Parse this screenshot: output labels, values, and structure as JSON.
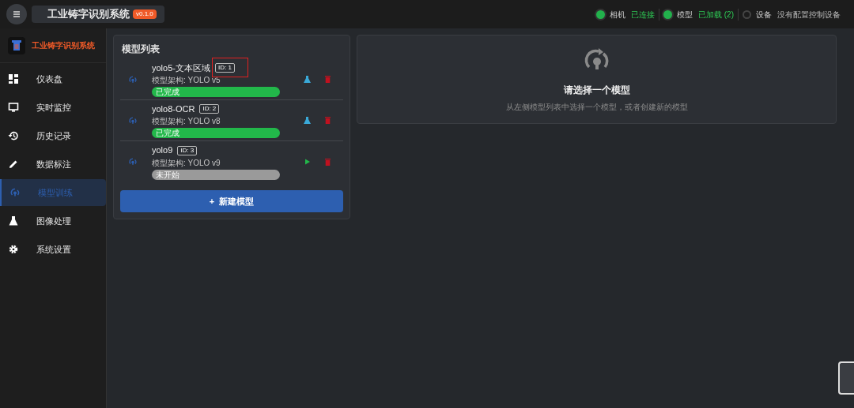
{
  "header": {
    "title": "工业铸字识别系统",
    "version": "v0.1.0"
  },
  "status": [
    {
      "label": "相机",
      "value": "已连接",
      "on": true
    },
    {
      "label": "模型",
      "value": "已加载 (2)",
      "on": true
    },
    {
      "label": "设备",
      "value": "没有配置控制设备",
      "on": false
    }
  ],
  "sidebar": {
    "brand": "工业铸字识别系统",
    "items": [
      {
        "label": "仪表盘",
        "selected": false
      },
      {
        "label": "实时监控",
        "selected": false
      },
      {
        "label": "历史记录",
        "selected": false
      },
      {
        "label": "数据标注",
        "selected": false
      },
      {
        "label": "模型训练",
        "selected": true
      },
      {
        "label": "图像处理",
        "selected": false
      },
      {
        "label": "系统设置",
        "selected": false
      }
    ]
  },
  "model_list": {
    "title": "模型列表",
    "models": [
      {
        "name": "yolo5-文本区域",
        "id": "ID: 1",
        "arch": "模型架构: YOLO v5",
        "status": "已完成",
        "kind": "done",
        "highlighted": true
      },
      {
        "name": "yolo8-OCR",
        "id": "ID: 2",
        "arch": "模型架构: YOLO v8",
        "status": "已完成",
        "kind": "done",
        "highlighted": false
      },
      {
        "name": "yolo9",
        "id": "ID: 3",
        "arch": "模型架构: YOLO v9",
        "status": "未开始",
        "kind": "pending",
        "highlighted": false
      }
    ],
    "new_button": "+  新建模型"
  },
  "detail": {
    "title": "请选择一个模型",
    "hint": "从左侧模型列表中选择一个模型，或者创建新的模型"
  }
}
